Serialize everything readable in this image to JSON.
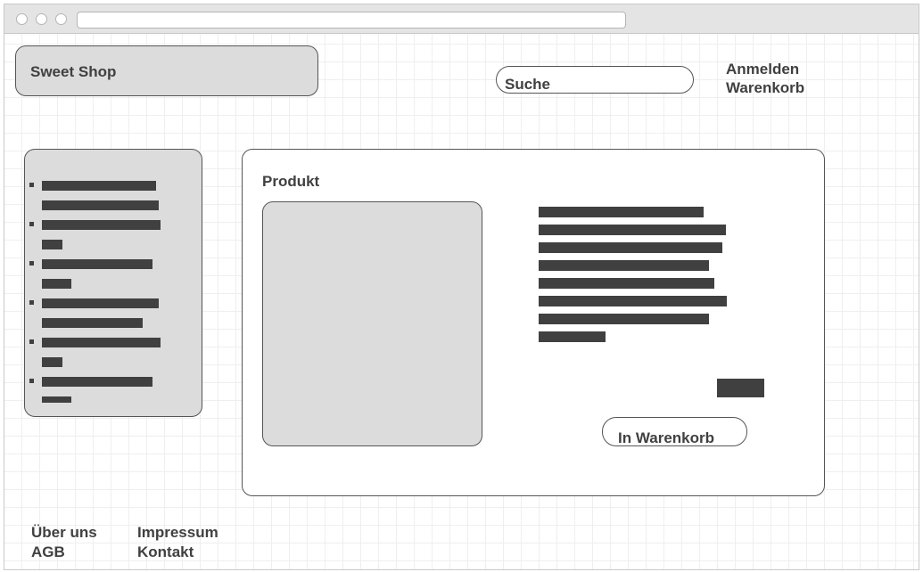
{
  "header": {
    "logo_text": "Sweet Shop",
    "search_label": "Suche",
    "nav": [
      "Anmelden",
      "Warenkorb"
    ]
  },
  "product": {
    "heading": "Produkt",
    "add_to_cart_label": "In Warenkorb"
  },
  "footer": {
    "col1": [
      "Über uns",
      "AGB"
    ],
    "col2": [
      "Impressum",
      "Kontakt"
    ]
  },
  "colors": {
    "placeholder_fill": "#dcdcdc",
    "text_bar": "#404040",
    "border": "#555555"
  }
}
